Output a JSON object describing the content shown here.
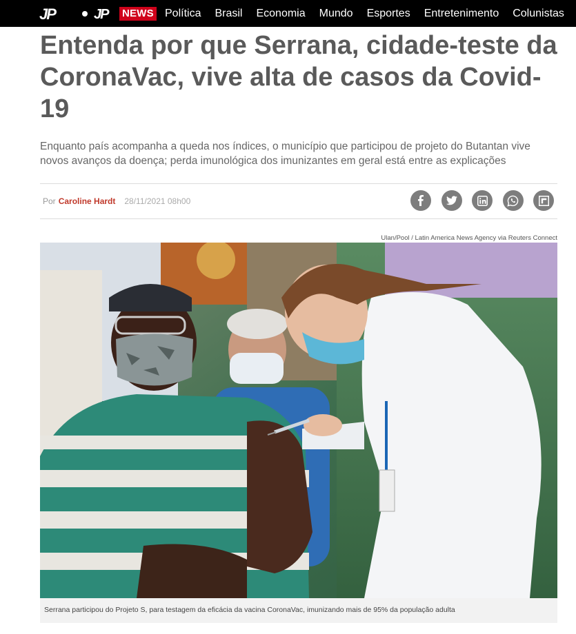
{
  "topbar": {
    "logo_text": "JP",
    "news_logo_text": "JP",
    "news_badge": "NEWS",
    "nav": [
      "Política",
      "Brasil",
      "Economia",
      "Mundo",
      "Esportes",
      "Entretenimento",
      "Colunistas"
    ]
  },
  "article": {
    "title": "Entenda por que Serrana, cidade-teste da CoronaVac, vive alta de casos da Covid-19",
    "subtitle": "Enquanto país acompanha a queda nos índices, o município que participou de projeto do Butantan vive novos avanços da doença; perda imunológica dos imunizantes em geral está entre as explicações",
    "byline_prefix": "Por",
    "author": "Caroline Hardt",
    "date": "28/11/2021 08h00",
    "photo_credit": "Ulan/Pool / Latin America News Agency via Reuters Connect",
    "caption": "Serrana participou do Projeto S, para testagem da eficácia da vacina CoronaVac, imunizando mais de 95% da população adulta"
  },
  "share": [
    {
      "icon": "facebook-icon"
    },
    {
      "icon": "twitter-icon"
    },
    {
      "icon": "linkedin-icon"
    },
    {
      "icon": "whatsapp-icon"
    },
    {
      "icon": "flipboard-icon"
    }
  ],
  "colors": {
    "topbar_bg": "#000000",
    "brand_red": "#d0021b",
    "headline": "#5a5a5a",
    "author": "#c0392b",
    "share_bg": "#7d7d7d"
  }
}
